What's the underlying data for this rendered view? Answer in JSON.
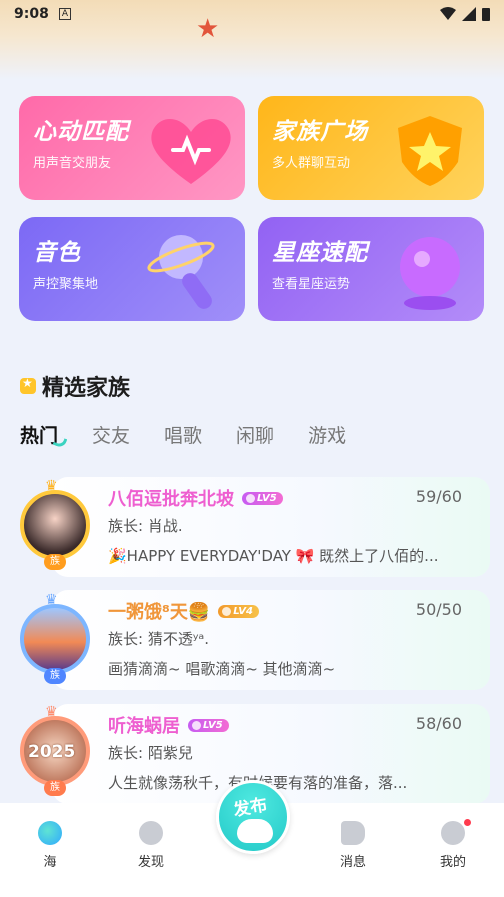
{
  "status_bar": {
    "time": "9:08",
    "indicator": "A"
  },
  "cards": [
    {
      "title": "心动匹配",
      "subtitle": "用声音交朋友",
      "icon": "heart-icon"
    },
    {
      "title": "家族广场",
      "subtitle": "多人群聊互动",
      "icon": "star-shield-icon"
    },
    {
      "title": "音色",
      "subtitle": "声控聚集地",
      "icon": "microphone-icon"
    },
    {
      "title": "星座速配",
      "subtitle": "查看星座运势",
      "icon": "crystal-ball-icon"
    }
  ],
  "section": {
    "title": "精选家族"
  },
  "tabs": [
    "热门",
    "交友",
    "唱歌",
    "闲聊",
    "游戏"
  ],
  "families": [
    {
      "name": "八佰逗批奔北坡",
      "level": "LV5",
      "count": "59/60",
      "leader": "族长: 肖战.",
      "desc": "🎉HAPPY EVERYDAY'DAY 🎀  既然上了八佰的...",
      "badge": "族"
    },
    {
      "name": "一粥饿⁸天🍔",
      "level": "LV4",
      "count": "50/50",
      "leader": "族长: 猜不透ʸᵃ.",
      "desc": "画猜滴滴~ 唱歌滴滴~ 其他滴滴~",
      "badge": "族"
    },
    {
      "name": "听海蜗居",
      "level": "LV5",
      "count": "58/60",
      "leader": "族长: 陌紫兒",
      "desc": "人生就像荡秋千，有时候要有落的准备，落...",
      "badge": "族",
      "year": "2025"
    }
  ],
  "bottom_nav": {
    "items": [
      {
        "label": "海",
        "icon": "sea-icon"
      },
      {
        "label": "发现",
        "icon": "compass-icon"
      },
      {
        "label": "消息",
        "icon": "megaphone-icon"
      },
      {
        "label": "我的",
        "icon": "profile-icon"
      }
    ],
    "publish_label": "发布"
  }
}
